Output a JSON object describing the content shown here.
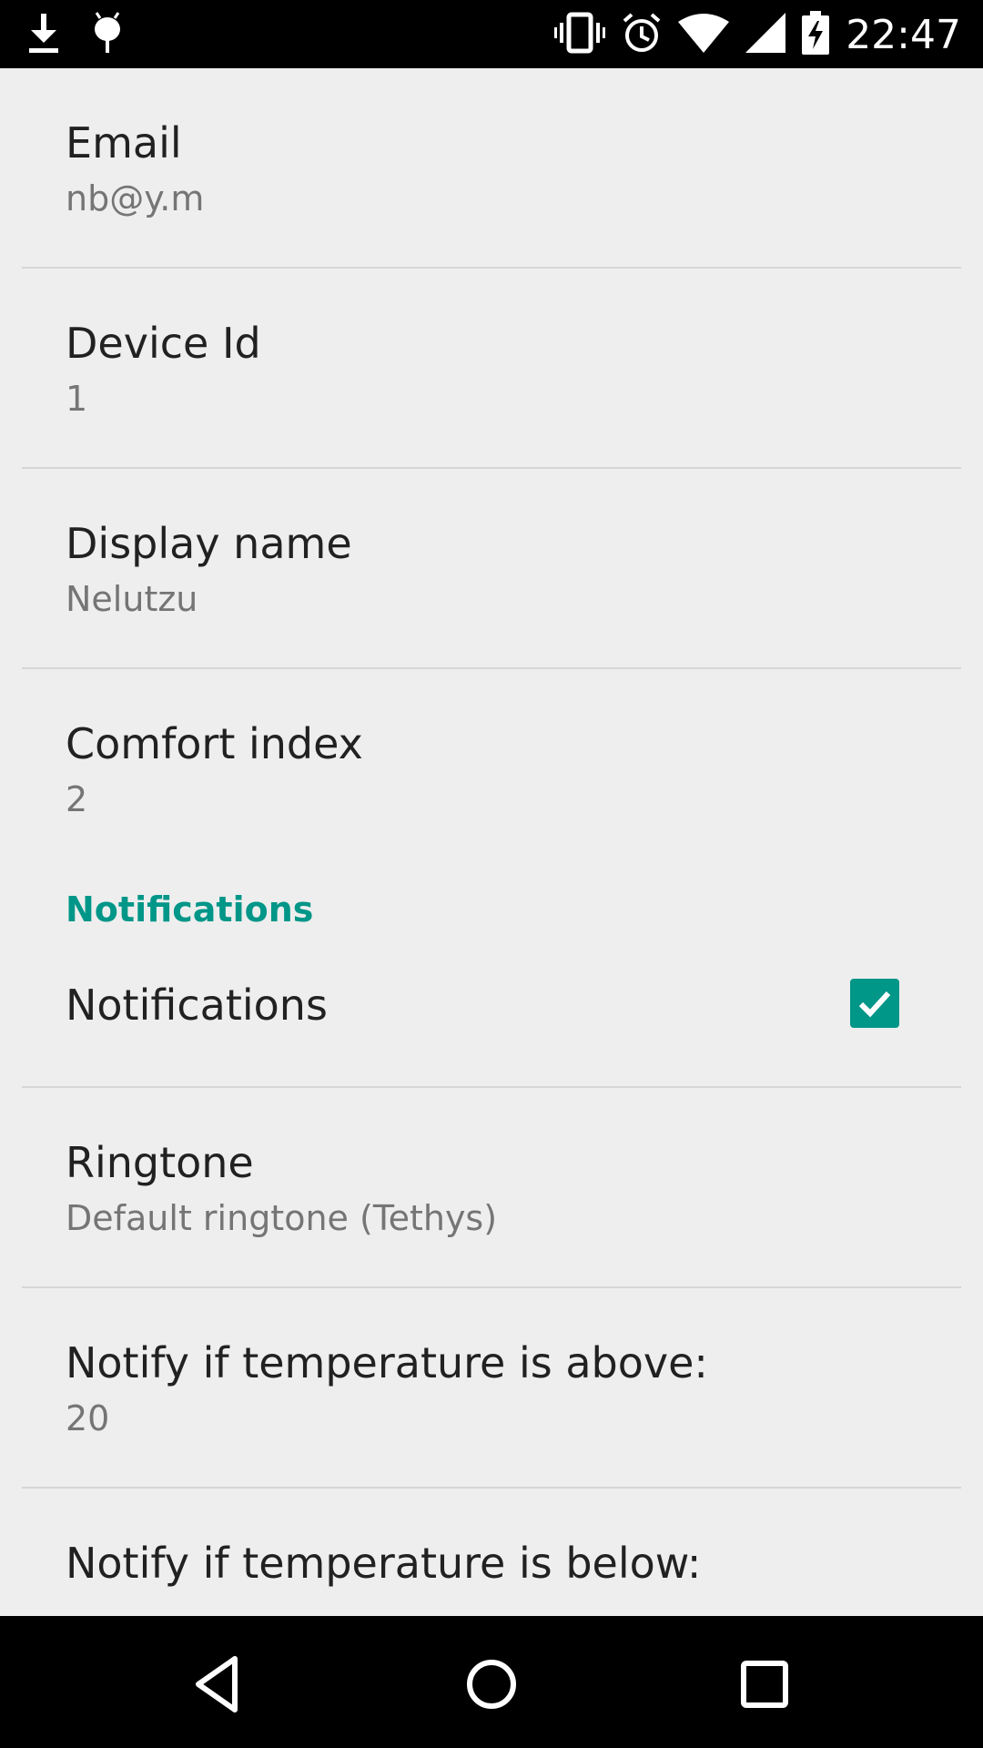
{
  "status_bar": {
    "time": "22:47",
    "icons_left": [
      "download-icon",
      "android-debug-icon"
    ],
    "icons_right": [
      "vibrate-icon",
      "alarm-icon",
      "wifi-icon",
      "cell-signal-icon",
      "battery-charging-icon"
    ]
  },
  "preferences": {
    "email": {
      "title": "Email",
      "summary": "nb@y.m"
    },
    "device_id": {
      "title": "Device Id",
      "summary": "1"
    },
    "display_name": {
      "title": "Display name",
      "summary": "Nelutzu"
    },
    "comfort_index": {
      "title": "Comfort index",
      "summary": "2"
    },
    "notifications_category": {
      "title": "Notifications"
    },
    "notifications_toggle": {
      "title": "Notifications",
      "checked": true
    },
    "ringtone": {
      "title": "Ringtone",
      "summary": "Default ringtone (Tethys)"
    },
    "temp_above": {
      "title": "Notify if temperature is above:",
      "summary": "20"
    },
    "temp_below": {
      "title": "Notify if temperature is below:"
    }
  },
  "colors": {
    "accent": "#009688",
    "background": "#eeeeee",
    "title_text": "#212121",
    "summary_text": "#757575"
  },
  "nav_bar": {
    "buttons": [
      "back-icon",
      "home-icon",
      "recents-icon"
    ]
  }
}
